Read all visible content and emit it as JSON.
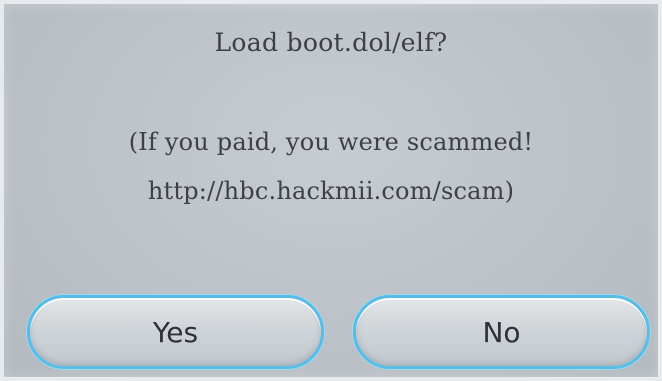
{
  "dialog": {
    "title": "Load boot.dol/elf?",
    "message_line1": "(If you paid, you were scammed!",
    "message_line2": "http://hbc.hackmii.com/scam)"
  },
  "buttons": {
    "yes_label": "Yes",
    "no_label": "No"
  },
  "colors": {
    "background": "#bcc2c8",
    "button_border": "#58bde6",
    "text": "#3d4146"
  }
}
